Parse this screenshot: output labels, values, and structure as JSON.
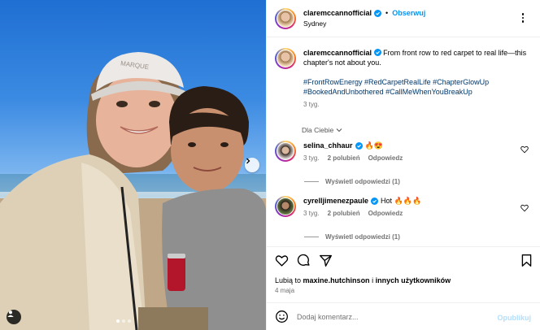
{
  "post": {
    "author": "claremccannofficial",
    "follow_label": "Obserwuj",
    "separator": "•",
    "location": "Sydney",
    "image_alt_people": "selfie",
    "cap_text": "MARQUE"
  },
  "caption": {
    "username": "claremccannofficial",
    "text": "From front row to red carpet to real life—this chapter's not about you.",
    "hashtags": "#FrontRowEnergy #RedCarpetRealLife #ChapterGlowUp #BookedAndUnbothered #CallMeWhenYouBreakUp",
    "time": "3 tyg."
  },
  "filter": {
    "label": "Dla Ciebie"
  },
  "comments": [
    {
      "username": "selina_chhaur",
      "text": "🔥😍",
      "time": "3 tyg.",
      "likes": "2 polubień",
      "reply_label": "Odpowiedz",
      "replies_label": "Wyświetl odpowiedzi (1)"
    },
    {
      "username": "cyrelljimenezpaule",
      "text": "Hot 🔥🔥🔥",
      "time": "3 tyg.",
      "likes": "2 polubień",
      "reply_label": "Odpowiedz",
      "replies_label": "Wyświetl odpowiedzi (1)"
    }
  ],
  "likes": {
    "prefix": "Lubią to",
    "user": "maxine.hutchinson",
    "conj": "i",
    "others": "innych użytkowników"
  },
  "date": "4 maja",
  "composer": {
    "placeholder": "Dodaj komentarz...",
    "publish_label": "Opublikuj"
  },
  "carousel": {
    "count": 3,
    "active": 1
  },
  "colors": {
    "accent": "#0095f6",
    "hashtag": "#00376b",
    "muted": "#737373",
    "publish_disabled": "#b2dffc"
  }
}
